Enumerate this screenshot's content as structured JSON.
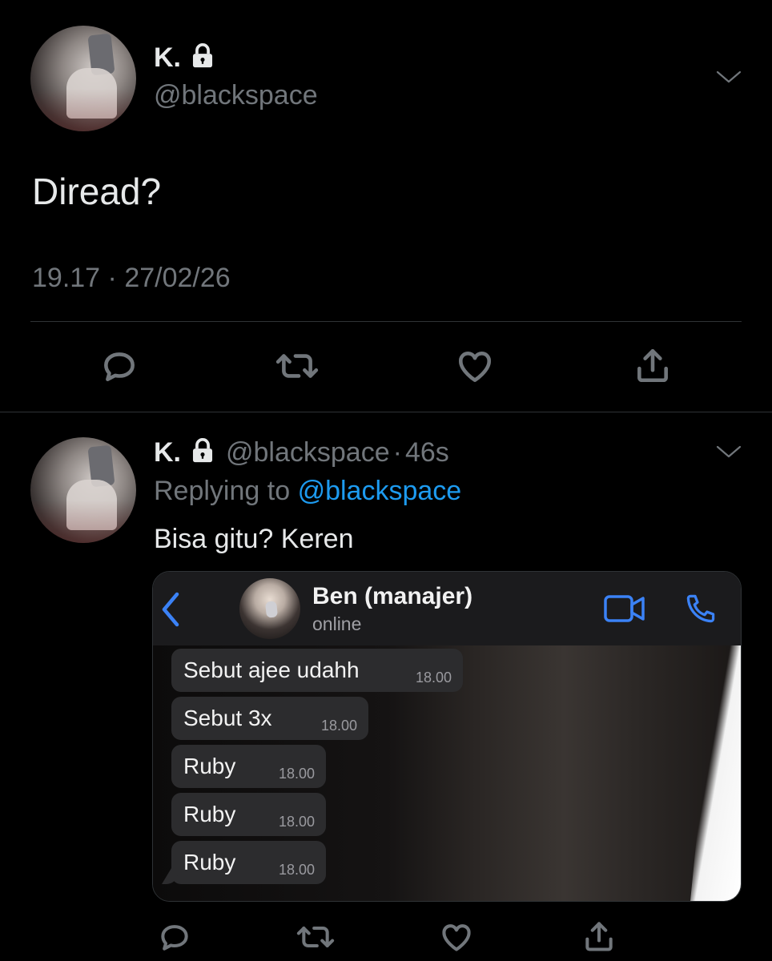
{
  "main_tweet": {
    "display_name": "K.",
    "handle": "@blackspace",
    "text": "Diread?",
    "time": "19.17",
    "separator": "·",
    "date": "27/02/26"
  },
  "reply_tweet": {
    "display_name": "K.",
    "handle": "@blackspace",
    "separator": "·",
    "age": "46s",
    "replying_prefix": "Replying to",
    "replying_handle": "@blackspace",
    "text": "Bisa gitu? Keren"
  },
  "chat_screenshot": {
    "contact_name": "Ben (manajer)",
    "status": "online",
    "messages": [
      {
        "text": "Sebut ajee udahh",
        "time": "18.00"
      },
      {
        "text": "Sebut 3x",
        "time": "18.00"
      },
      {
        "text": "Ruby",
        "time": "18.00"
      },
      {
        "text": "Ruby",
        "time": "18.00"
      },
      {
        "text": "Ruby",
        "time": "18.00"
      }
    ]
  },
  "colors": {
    "background": "#000000",
    "primary_text": "#e7e9ea",
    "secondary_text": "#71767b",
    "link": "#1d9bf0",
    "chat_accent": "#3b82f6"
  },
  "icons": [
    "lock-icon",
    "chevron-down-icon",
    "reply-icon",
    "retweet-icon",
    "like-icon",
    "share-icon",
    "back-chevron-icon",
    "video-call-icon",
    "phone-call-icon"
  ]
}
